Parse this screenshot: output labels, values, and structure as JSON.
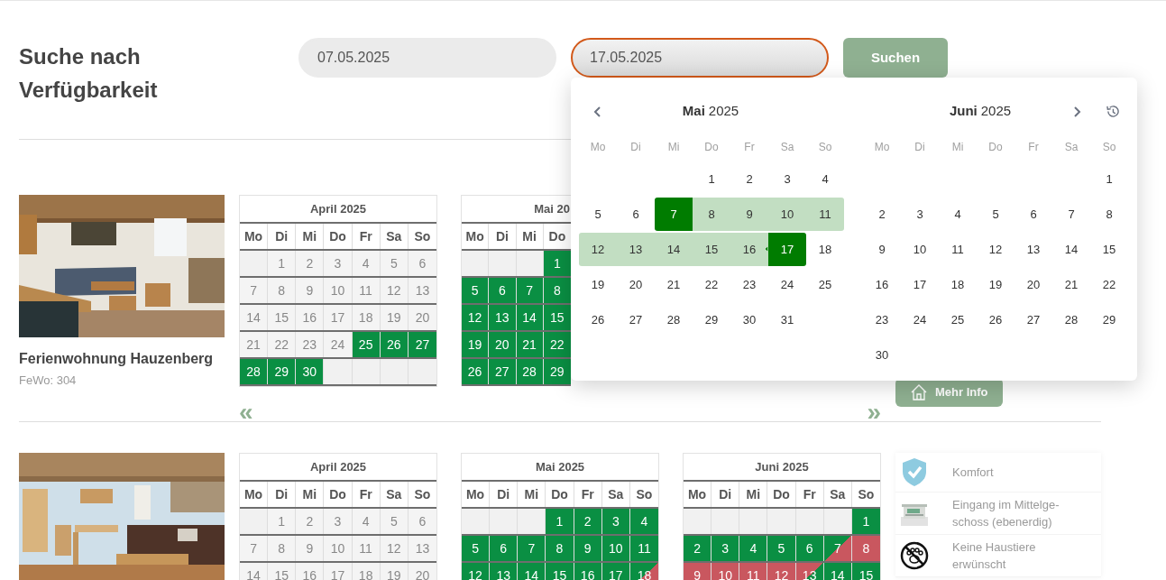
{
  "search": {
    "title": "Suche nach Verfügbarkeit",
    "fields": [
      {
        "value": "07.05.2025",
        "focused": false
      },
      {
        "value": "17.05.2025",
        "focused": true
      }
    ],
    "button": "Suchen"
  },
  "datepicker": {
    "months": [
      {
        "month": "Mai",
        "year": "2025",
        "weekdays": [
          "Mo",
          "Di",
          "Mi",
          "Do",
          "Fr",
          "Sa",
          "So"
        ],
        "weeks": [
          [
            {
              "day": "1",
              "selected": false,
              "in_range": false
            },
            {
              "day": "2",
              "selected": false,
              "in_range": false
            },
            {
              "day": "3",
              "selected": false,
              "in_range": false
            },
            {
              "day": "4",
              "selected": false,
              "in_range": false
            }
          ],
          [
            {
              "day": "5",
              "selected": false,
              "in_range": false
            },
            {
              "day": "6",
              "selected": false,
              "in_range": false
            },
            {
              "day": "7",
              "selected": true,
              "in_range": true
            },
            {
              "day": "8",
              "selected": false,
              "in_range": true
            },
            {
              "day": "9",
              "selected": false,
              "in_range": true
            },
            {
              "day": "10",
              "selected": false,
              "in_range": true
            },
            {
              "day": "11",
              "selected": false,
              "in_range": true
            }
          ],
          [
            {
              "day": "12",
              "selected": false,
              "in_range": true
            },
            {
              "day": "13",
              "selected": false,
              "in_range": true
            },
            {
              "day": "14",
              "selected": false,
              "in_range": true
            },
            {
              "day": "15",
              "selected": false,
              "in_range": true
            },
            {
              "day": "16",
              "selected": false,
              "in_range": true
            },
            {
              "day": "17",
              "selected": true,
              "in_range": true
            },
            {
              "day": "18",
              "selected": false,
              "in_range": false
            }
          ],
          [
            {
              "day": "19",
              "selected": false,
              "in_range": false
            },
            {
              "day": "20",
              "selected": false,
              "in_range": false
            },
            {
              "day": "21",
              "selected": false,
              "in_range": false
            },
            {
              "day": "22",
              "selected": false,
              "in_range": false
            },
            {
              "day": "23",
              "selected": false,
              "in_range": false
            },
            {
              "day": "24",
              "selected": false,
              "in_range": false
            },
            {
              "day": "25",
              "selected": false,
              "in_range": false
            }
          ],
          [
            {
              "day": "26",
              "selected": false,
              "in_range": false
            },
            {
              "day": "27",
              "selected": false,
              "in_range": false
            },
            {
              "day": "28",
              "selected": false,
              "in_range": false
            },
            {
              "day": "29",
              "selected": false,
              "in_range": false
            },
            {
              "day": "30",
              "selected": false,
              "in_range": false
            },
            {
              "day": "31",
              "selected": false,
              "in_range": false
            }
          ]
        ]
      },
      {
        "month": "Juni",
        "year": "2025",
        "weekdays": [
          "Mo",
          "Di",
          "Mi",
          "Do",
          "Fr",
          "Sa",
          "So"
        ],
        "weeks": [
          [
            {
              "day": "1",
              "selected": false,
              "in_range": false
            }
          ],
          [
            {
              "day": "2",
              "selected": false,
              "in_range": false
            },
            {
              "day": "3",
              "selected": false,
              "in_range": false
            },
            {
              "day": "4",
              "selected": false,
              "in_range": false
            },
            {
              "day": "5",
              "selected": false,
              "in_range": false
            },
            {
              "day": "6",
              "selected": false,
              "in_range": false
            },
            {
              "day": "7",
              "selected": false,
              "in_range": false
            },
            {
              "day": "8",
              "selected": false,
              "in_range": false
            }
          ],
          [
            {
              "day": "9",
              "selected": false,
              "in_range": false
            },
            {
              "day": "10",
              "selected": false,
              "in_range": false
            },
            {
              "day": "11",
              "selected": false,
              "in_range": false
            },
            {
              "day": "12",
              "selected": false,
              "in_range": false
            },
            {
              "day": "13",
              "selected": false,
              "in_range": false
            },
            {
              "day": "14",
              "selected": false,
              "in_range": false
            },
            {
              "day": "15",
              "selected": false,
              "in_range": false
            }
          ],
          [
            {
              "day": "16",
              "selected": false,
              "in_range": false
            },
            {
              "day": "17",
              "selected": false,
              "in_range": false
            },
            {
              "day": "18",
              "selected": false,
              "in_range": false
            },
            {
              "day": "19",
              "selected": false,
              "in_range": false
            },
            {
              "day": "20",
              "selected": false,
              "in_range": false
            },
            {
              "day": "21",
              "selected": false,
              "in_range": false
            },
            {
              "day": "22",
              "selected": false,
              "in_range": false
            }
          ],
          [
            {
              "day": "23",
              "selected": false,
              "in_range": false
            },
            {
              "day": "24",
              "selected": false,
              "in_range": false
            },
            {
              "day": "25",
              "selected": false,
              "in_range": false
            },
            {
              "day": "26",
              "selected": false,
              "in_range": false
            },
            {
              "day": "27",
              "selected": false,
              "in_range": false
            },
            {
              "day": "28",
              "selected": false,
              "in_range": false
            },
            {
              "day": "29",
              "selected": false,
              "in_range": false
            }
          ],
          [
            {
              "day": "30",
              "selected": false,
              "in_range": false
            }
          ]
        ]
      }
    ]
  },
  "listings": [
    {
      "image": {
        "kind": "picture"
      },
      "name": "Ferienwohnung Hauzenberg",
      "code": "FeWo: 304",
      "calendars": [
        {
          "title": "April 2025",
          "weekdays": [
            "Mo",
            "Di",
            "Mi",
            "Do",
            "Fr",
            "Sa",
            "So"
          ],
          "weeks": [
            [
              {
                "kind": "blank"
              },
              {
                "day": "1",
                "kind": "past"
              },
              {
                "day": "2",
                "kind": "past"
              },
              {
                "day": "3",
                "kind": "past"
              },
              {
                "day": "4",
                "kind": "past"
              },
              {
                "day": "5",
                "kind": "past"
              },
              {
                "day": "6",
                "kind": "past"
              }
            ],
            [
              {
                "day": "7",
                "kind": "past"
              },
              {
                "day": "8",
                "kind": "past"
              },
              {
                "day": "9",
                "kind": "past"
              },
              {
                "day": "10",
                "kind": "past"
              },
              {
                "day": "11",
                "kind": "past"
              },
              {
                "day": "12",
                "kind": "past"
              },
              {
                "day": "13",
                "kind": "past"
              }
            ],
            [
              {
                "day": "14",
                "kind": "past"
              },
              {
                "day": "15",
                "kind": "past"
              },
              {
                "day": "16",
                "kind": "past"
              },
              {
                "day": "17",
                "kind": "past"
              },
              {
                "day": "18",
                "kind": "past"
              },
              {
                "day": "19",
                "kind": "past"
              },
              {
                "day": "20",
                "kind": "past"
              }
            ],
            [
              {
                "day": "21",
                "kind": "past"
              },
              {
                "day": "22",
                "kind": "past"
              },
              {
                "day": "23",
                "kind": "past"
              },
              {
                "day": "24",
                "kind": "past"
              },
              {
                "day": "25",
                "kind": "free"
              },
              {
                "day": "26",
                "kind": "free"
              },
              {
                "day": "27",
                "kind": "free"
              }
            ],
            [
              {
                "day": "28",
                "kind": "free"
              },
              {
                "day": "29",
                "kind": "free"
              },
              {
                "day": "30",
                "kind": "free"
              },
              {
                "kind": "blank"
              },
              {
                "kind": "blank"
              },
              {
                "kind": "blank"
              },
              {
                "kind": "blank"
              }
            ]
          ]
        },
        {
          "title": "Mai 20",
          "weekdays": [
            "Mo",
            "Di",
            "Mi",
            "Do"
          ],
          "weeks": [
            [
              {
                "kind": "blank"
              },
              {
                "kind": "blank"
              },
              {
                "kind": "blank"
              },
              {
                "day": "1",
                "kind": "free"
              }
            ],
            [
              {
                "day": "5",
                "kind": "free"
              },
              {
                "day": "6",
                "kind": "free"
              },
              {
                "day": "7",
                "kind": "free"
              },
              {
                "day": "8",
                "kind": "free"
              }
            ],
            [
              {
                "day": "12",
                "kind": "free"
              },
              {
                "day": "13",
                "kind": "free"
              },
              {
                "day": "14",
                "kind": "free"
              },
              {
                "day": "15",
                "kind": "free"
              }
            ],
            [
              {
                "day": "19",
                "kind": "free"
              },
              {
                "day": "20",
                "kind": "free"
              },
              {
                "day": "21",
                "kind": "free"
              },
              {
                "day": "22",
                "kind": "free"
              }
            ],
            [
              {
                "day": "26",
                "kind": "free"
              },
              {
                "day": "27",
                "kind": "free"
              },
              {
                "day": "28",
                "kind": "free"
              },
              {
                "day": "29",
                "kind": "free"
              }
            ]
          ]
        }
      ],
      "prev": "«",
      "next": "»",
      "more_button": "Mehr Info"
    },
    {
      "image": {
        "kind": "picture"
      },
      "calendars": [
        {
          "title": "April 2025",
          "weekdays": [
            "Mo",
            "Di",
            "Mi",
            "Do",
            "Fr",
            "Sa",
            "So"
          ],
          "weeks": [
            [
              {
                "kind": "blank"
              },
              {
                "day": "1",
                "kind": "past"
              },
              {
                "day": "2",
                "kind": "past"
              },
              {
                "day": "3",
                "kind": "past"
              },
              {
                "day": "4",
                "kind": "past"
              },
              {
                "day": "5",
                "kind": "past"
              },
              {
                "day": "6",
                "kind": "past"
              }
            ],
            [
              {
                "day": "7",
                "kind": "past"
              },
              {
                "day": "8",
                "kind": "past"
              },
              {
                "day": "9",
                "kind": "past"
              },
              {
                "day": "10",
                "kind": "past"
              },
              {
                "day": "11",
                "kind": "past"
              },
              {
                "day": "12",
                "kind": "past"
              },
              {
                "day": "13",
                "kind": "past"
              }
            ],
            [
              {
                "day": "14",
                "kind": "past"
              },
              {
                "day": "15",
                "kind": "past"
              },
              {
                "day": "16",
                "kind": "past"
              },
              {
                "day": "17",
                "kind": "past"
              },
              {
                "day": "18",
                "kind": "past"
              },
              {
                "day": "19",
                "kind": "past"
              },
              {
                "day": "20",
                "kind": "past"
              }
            ]
          ]
        },
        {
          "title": "Mai 2025",
          "weekdays": [
            "Mo",
            "Di",
            "Mi",
            "Do",
            "Fr",
            "Sa",
            "So"
          ],
          "weeks": [
            [
              {
                "kind": "blank"
              },
              {
                "kind": "blank"
              },
              {
                "kind": "blank"
              },
              {
                "day": "1",
                "kind": "free"
              },
              {
                "day": "2",
                "kind": "free"
              },
              {
                "day": "3",
                "kind": "free"
              },
              {
                "day": "4",
                "kind": "free"
              }
            ],
            [
              {
                "day": "5",
                "kind": "free"
              },
              {
                "day": "6",
                "kind": "free"
              },
              {
                "day": "7",
                "kind": "free"
              },
              {
                "day": "8",
                "kind": "free"
              },
              {
                "day": "9",
                "kind": "free"
              },
              {
                "day": "10",
                "kind": "free"
              },
              {
                "day": "11",
                "kind": "free"
              }
            ],
            [
              {
                "day": "12",
                "kind": "free"
              },
              {
                "day": "13",
                "kind": "free"
              },
              {
                "day": "14",
                "kind": "free"
              },
              {
                "day": "15",
                "kind": "free"
              },
              {
                "day": "16",
                "kind": "free"
              },
              {
                "day": "17",
                "kind": "free"
              },
              {
                "day": "18",
                "kind": "arrival"
              }
            ]
          ]
        },
        {
          "title": "Juni 2025",
          "weekdays": [
            "Mo",
            "Di",
            "Mi",
            "Do",
            "Fr",
            "Sa",
            "So"
          ],
          "weeks": [
            [
              {
                "kind": "blank"
              },
              {
                "kind": "blank"
              },
              {
                "kind": "blank"
              },
              {
                "kind": "blank"
              },
              {
                "kind": "blank"
              },
              {
                "kind": "blank"
              },
              {
                "day": "1",
                "kind": "free"
              }
            ],
            [
              {
                "day": "2",
                "kind": "free"
              },
              {
                "day": "3",
                "kind": "free"
              },
              {
                "day": "4",
                "kind": "free"
              },
              {
                "day": "5",
                "kind": "free"
              },
              {
                "day": "6",
                "kind": "free"
              },
              {
                "day": "7",
                "kind": "arrival"
              },
              {
                "day": "8",
                "kind": "booked"
              }
            ],
            [
              {
                "day": "9",
                "kind": "booked"
              },
              {
                "day": "10",
                "kind": "booked"
              },
              {
                "day": "11",
                "kind": "booked"
              },
              {
                "day": "12",
                "kind": "booked"
              },
              {
                "day": "13",
                "kind": "departure"
              },
              {
                "day": "14",
                "kind": "free"
              },
              {
                "day": "15",
                "kind": "free"
              }
            ]
          ]
        }
      ],
      "features": [
        {
          "kind": "shield",
          "label": "Komfort"
        },
        {
          "kind": "building",
          "label": "Eingang im Mittelge-schoss (ebenerdig)"
        },
        {
          "kind": "no-pets",
          "label": "Keine Haustiere erwünscht"
        }
      ]
    }
  ]
}
